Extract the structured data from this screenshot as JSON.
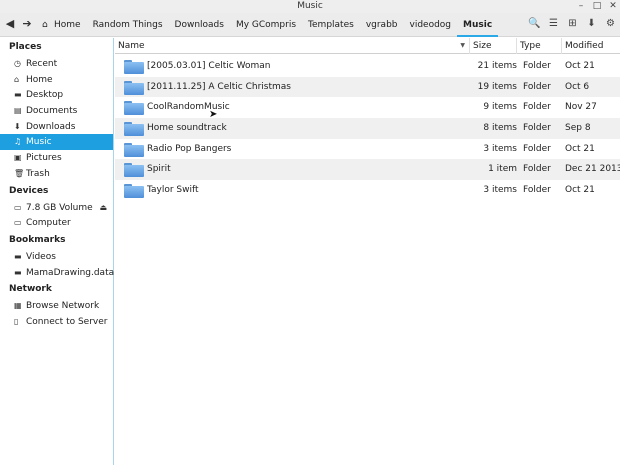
{
  "window": {
    "title": "Music"
  },
  "wm": {
    "minimize": "–",
    "maximize": "□",
    "close": "✕"
  },
  "toolbar": {
    "back_glyph": "◀",
    "forward_glyph": "➔",
    "crumbs": [
      {
        "label": "Home",
        "icon": "home-icon"
      },
      {
        "label": "Random Things"
      },
      {
        "label": "Downloads"
      },
      {
        "label": "My GCompris"
      },
      {
        "label": "Templates"
      },
      {
        "label": "vgrabb"
      },
      {
        "label": "videodog"
      },
      {
        "label": "Music",
        "active": true
      }
    ],
    "icons": {
      "search": "🔍",
      "list": "☰",
      "grid": "⊞",
      "download": "⬇",
      "settings": "⚙"
    }
  },
  "sidebar": {
    "places_header": "Places",
    "places": [
      {
        "label": "Recent",
        "icon": "clock-icon"
      },
      {
        "label": "Home",
        "icon": "home-icon"
      },
      {
        "label": "Desktop",
        "icon": "folder-icon"
      },
      {
        "label": "Documents",
        "icon": "document-icon"
      },
      {
        "label": "Downloads",
        "icon": "download-icon"
      },
      {
        "label": "Music",
        "icon": "music-icon",
        "selected": true
      },
      {
        "label": "Pictures",
        "icon": "picture-icon"
      },
      {
        "label": "Trash",
        "icon": "trash-icon"
      }
    ],
    "devices_header": "Devices",
    "devices": [
      {
        "label": "7.8 GB Volume",
        "icon": "drive-icon"
      },
      {
        "label": "Computer",
        "icon": "computer-icon"
      }
    ],
    "bookmarks_header": "Bookmarks",
    "bookmarks": [
      {
        "label": "Videos",
        "icon": "folder-icon"
      },
      {
        "label": "MamaDrawing.data",
        "icon": "folder-icon"
      }
    ],
    "network_header": "Network",
    "network": [
      {
        "label": "Browse Network",
        "icon": "network-icon"
      },
      {
        "label": "Connect to Server",
        "icon": "server-icon"
      }
    ]
  },
  "list": {
    "headers": {
      "name": "Name",
      "size": "Size",
      "type": "Type",
      "modified": "Modified"
    },
    "rows": [
      {
        "name": "[2005.03.01] Celtic Woman",
        "size": "21 items",
        "type": "Folder",
        "modified": "Oct 21"
      },
      {
        "name": "[2011.11.25] A Celtic Christmas",
        "size": "19 items",
        "type": "Folder",
        "modified": "Oct 6"
      },
      {
        "name": "CoolRandomMusic",
        "size": "9 items",
        "type": "Folder",
        "modified": "Nov 27"
      },
      {
        "name": "Home soundtrack",
        "size": "8 items",
        "type": "Folder",
        "modified": "Sep 8"
      },
      {
        "name": "Radio Pop Bangers",
        "size": "3 items",
        "type": "Folder",
        "modified": "Oct 21"
      },
      {
        "name": "Spirit",
        "size": "1 item",
        "type": "Folder",
        "modified": "Dec 21 2013"
      },
      {
        "name": "Taylor Swift",
        "size": "3 items",
        "type": "Folder",
        "modified": "Oct 21"
      }
    ]
  },
  "colors": {
    "accent": "#1e9fe0",
    "folder": "#5a95d6",
    "row_alt": "#f0f0f0"
  }
}
